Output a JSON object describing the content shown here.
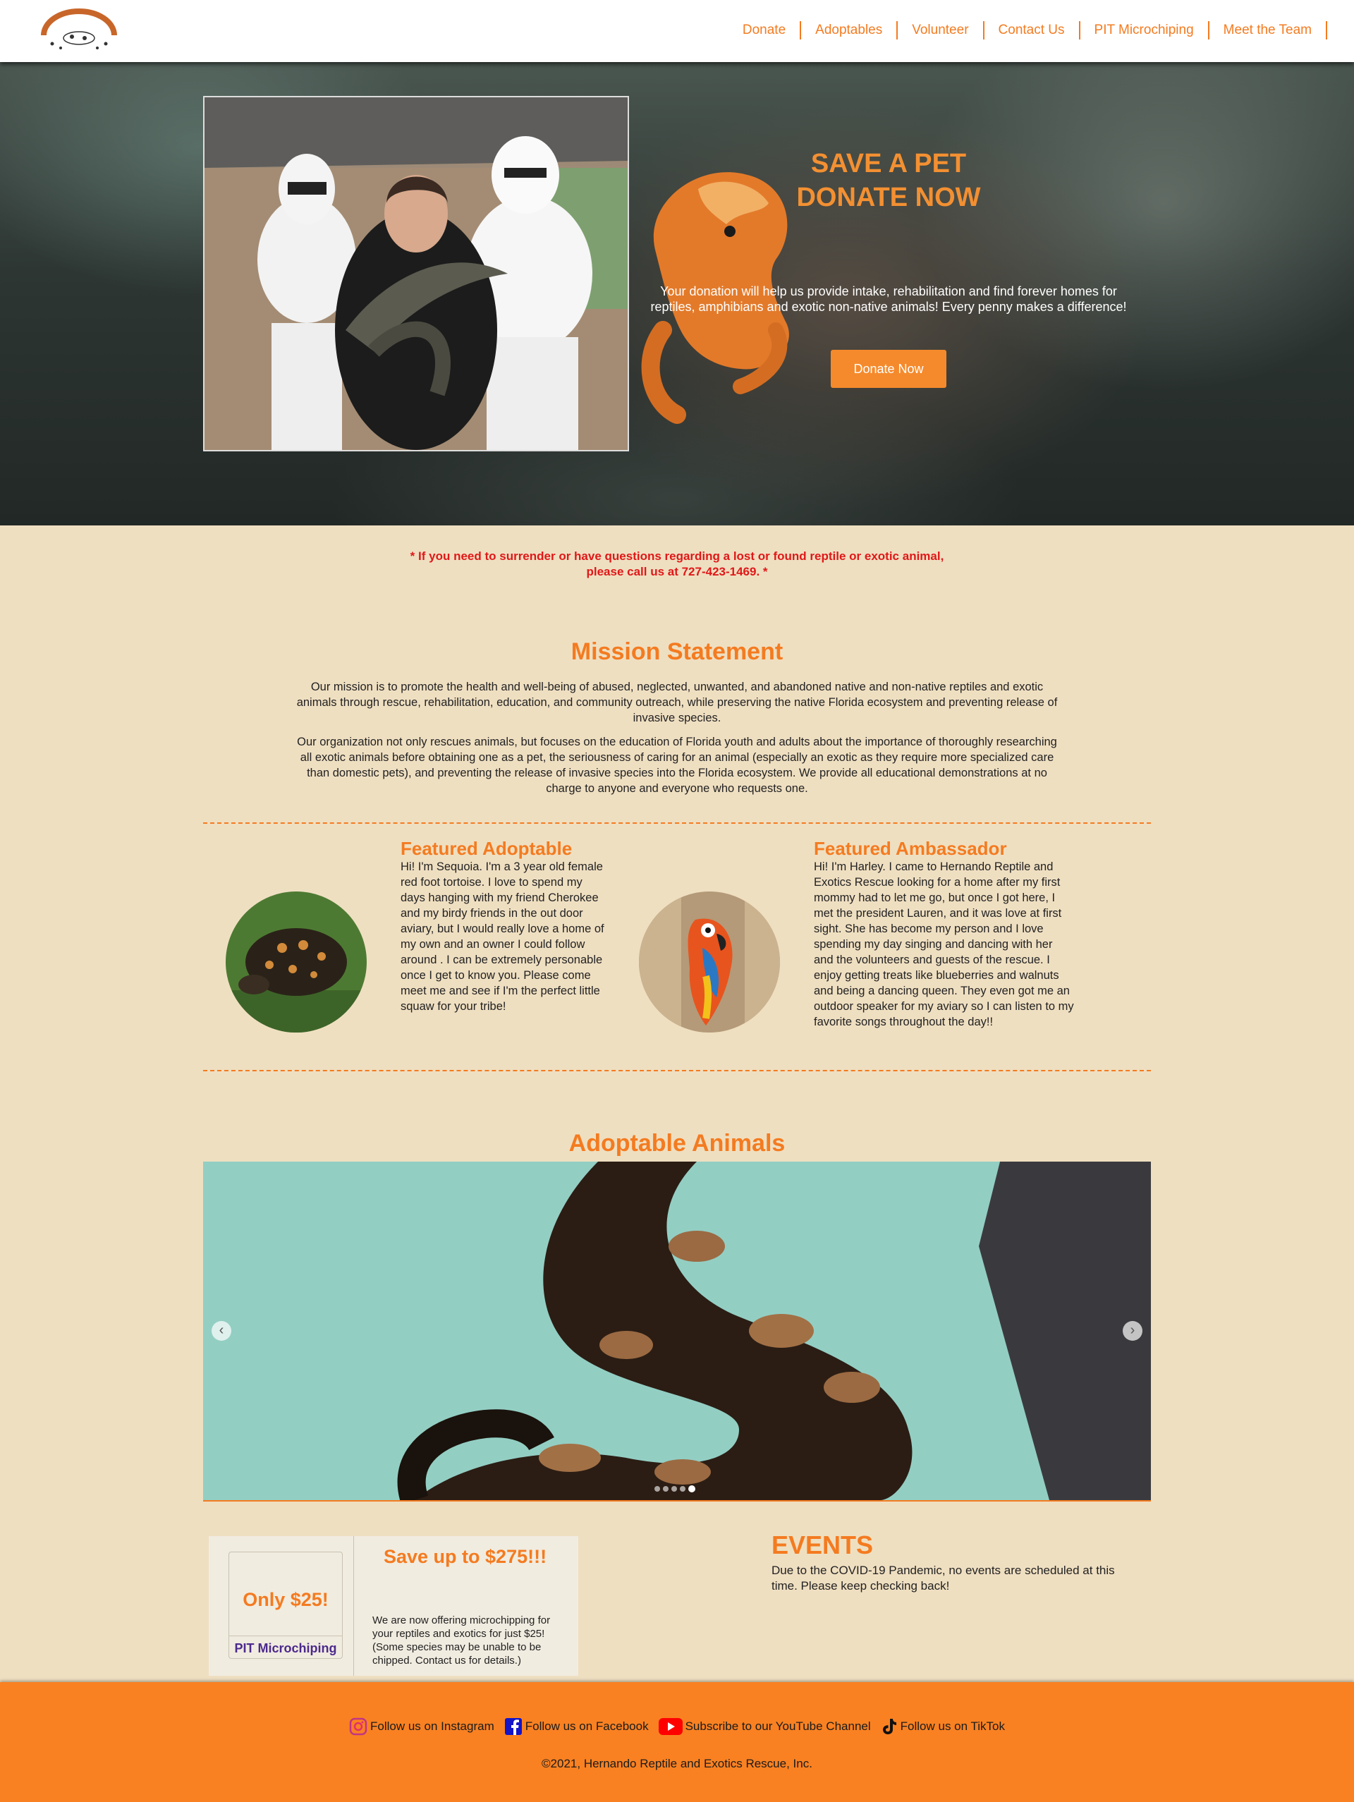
{
  "nav": {
    "items": [
      "Donate",
      "Adoptables",
      "Volunteer",
      "Contact Us",
      "PIT Microchiping",
      "Meet the Team"
    ]
  },
  "hero": {
    "title_line1": "SAVE A PET",
    "title_line2": "DONATE NOW",
    "description": "Your donation will help us provide intake, rehabilitation and find forever homes for reptiles, amphibians and exotic non-native animals! Every penny makes a difference!",
    "button": "Donate Now"
  },
  "notice": {
    "line1": "* If you need to surrender or have questions regarding a lost or found reptile or exotic animal,",
    "line2": "please call us at 727-423-1469. *"
  },
  "mission": {
    "title": "Mission Statement",
    "p1": "Our mission is to promote the health and well-being of abused, neglected, unwanted, and abandoned native and non-native reptiles and exotic animals through rescue, rehabilitation, education, and community outreach, while preserving the native Florida ecosystem and preventing release of invasive species.",
    "p2": "Our organization not only rescues animals, but focuses on the education of Florida youth and adults about the importance of thoroughly researching all exotic animals before obtaining one as a pet, the seriousness of caring for an animal (especially an exotic as they require more specialized care than domestic pets), and preventing the release of invasive species into the Florida ecosystem. We provide all educational demonstrations at no charge to anyone and everyone who requests one."
  },
  "featured_adoptable": {
    "title": "Featured Adoptable",
    "body": "Hi! I'm Sequoia. I'm a 3 year old female red foot tortoise. I love to spend my days hanging with my friend Cherokee and my birdy friends in the out door aviary, but I would really love a home of my own and an owner I could follow around . I can be extremely personable once I get to know you. Please come meet me and see if I'm the perfect little squaw for your tribe!"
  },
  "featured_ambassador": {
    "title": "Featured Ambassador",
    "body": "Hi! I'm Harley. I came to Hernando Reptile and Exotics Rescue looking for a home after my first mommy had to let me go, but once I got here, I met the president Lauren, and it was love at first sight. She has become my person and I love spending my day singing and dancing with her and the volunteers and guests of the rescue. I enjoy getting treats like blueberries and walnuts and being a dancing queen. They even got me an outdoor speaker for my aviary so I can listen to my favorite songs throughout the day!!"
  },
  "adoptables": {
    "title": "Adoptable Animals",
    "slide_count": 5,
    "active_slide": 5
  },
  "coupon": {
    "price": "Only $25!",
    "name": "PIT Microchiping",
    "save": "Save up to $275!!!",
    "text": "We are now offering microchipping for your reptiles and exotics for just $25! (Some species may be unable to be chipped. Contact us for details.)"
  },
  "events": {
    "title": "EVENTS",
    "text": "Due to the COVID-19 Pandemic, no events are scheduled at this time. Please keep checking back!"
  },
  "footer": {
    "instagram": "Follow us on Instagram",
    "facebook": "Follow us on Facebook",
    "youtube": "Subscribe to our YouTube Channel",
    "tiktok": "Follow us on TikTok",
    "copyright": "©2021, Hernando Reptile and Exotics Rescue, Inc."
  },
  "colors": {
    "accent": "#f47b20",
    "page_bg": "#efdfc1",
    "notice": "#e01818",
    "footer_bg": "#f98122"
  }
}
